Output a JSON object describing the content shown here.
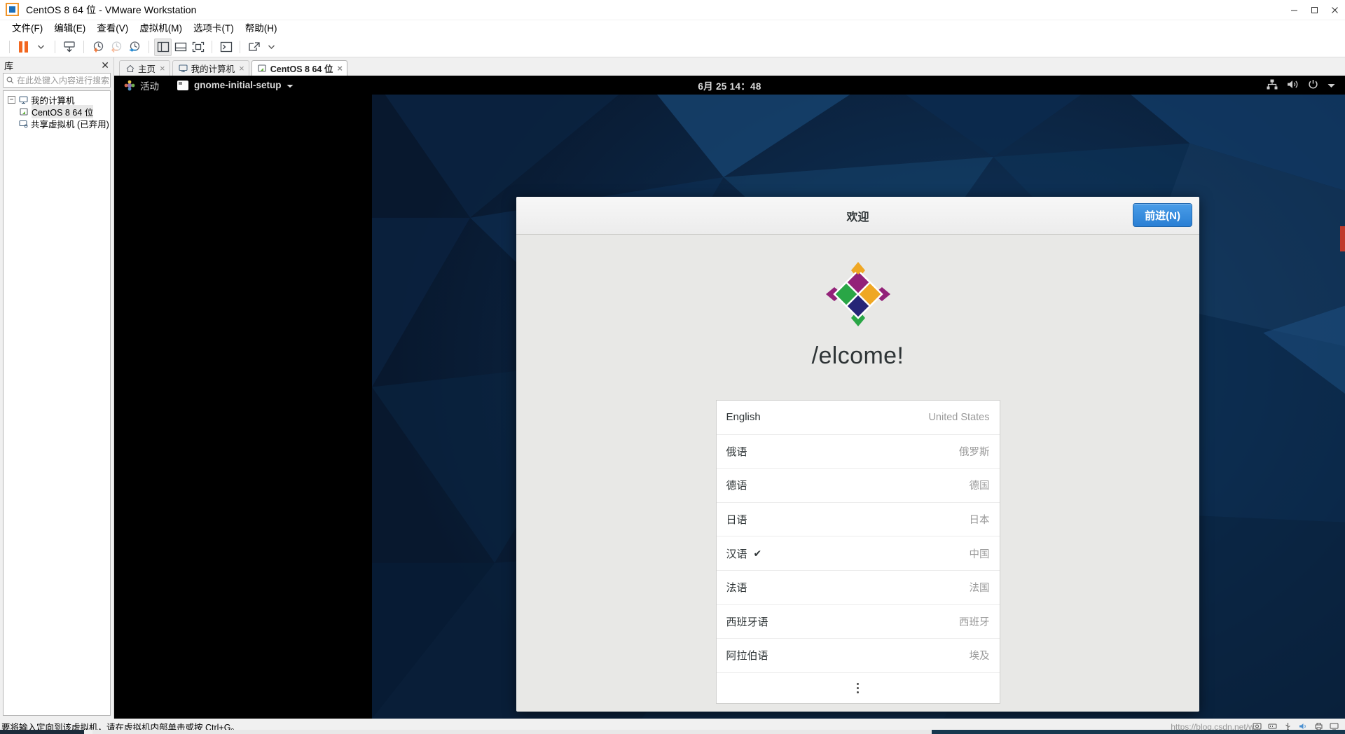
{
  "window": {
    "title": "CentOS 8 64 位 - VMware Workstation",
    "app_icon": "vmware-icon",
    "minimize": "minimize-icon",
    "maximize": "maximize-icon",
    "close": "close-icon"
  },
  "menubar": {
    "items": [
      {
        "label": "文件(F)",
        "name": "menu-file"
      },
      {
        "label": "编辑(E)",
        "name": "menu-edit"
      },
      {
        "label": "查看(V)",
        "name": "menu-view"
      },
      {
        "label": "虚拟机(M)",
        "name": "menu-vm"
      },
      {
        "label": "选项卡(T)",
        "name": "menu-tabs"
      },
      {
        "label": "帮助(H)",
        "name": "menu-help"
      }
    ]
  },
  "toolbar": {
    "buttons": [
      {
        "name": "power-pause-button",
        "icon": "pause-icon"
      },
      {
        "name": "power-dropdown-button",
        "icon": "chevron-down-icon"
      },
      {
        "name": "manage-snapshot-button",
        "icon": "snapshot-manager-icon"
      },
      {
        "name": "take-snapshot-button",
        "icon": "snapshot-add-icon"
      },
      {
        "name": "revert-snapshot-button",
        "icon": "snapshot-revert-icon"
      },
      {
        "name": "snapshot-manager-button",
        "icon": "snapshot-settings-icon"
      },
      {
        "name": "show-library-button",
        "icon": "sidebar-panel-icon"
      },
      {
        "name": "show-thumbnail-button",
        "icon": "thumbnail-bar-icon"
      },
      {
        "name": "fullscreen-button",
        "icon": "fullscreen-icon"
      },
      {
        "name": "console-button",
        "icon": "terminal-icon"
      },
      {
        "name": "unity-button",
        "icon": "unity-mode-icon"
      },
      {
        "name": "unity-dropdown-button",
        "icon": "chevron-down-icon"
      }
    ]
  },
  "sidebar": {
    "header": "库",
    "close_icon": "close-icon",
    "search": {
      "placeholder": "在此处键入内容进行搜索",
      "value": "",
      "icon": "search-icon",
      "dropdown_icon": "chevron-down-icon"
    },
    "tree": [
      {
        "label": "我的计算机",
        "icon": "computer-icon",
        "expander": "−",
        "indent": false,
        "selected": false
      },
      {
        "label": "CentOS 8 64 位",
        "icon": "vm-running-icon",
        "expander": "",
        "indent": true,
        "selected": true
      },
      {
        "label": "共享虚拟机 (已弃用)",
        "icon": "shared-vm-icon",
        "expander": "",
        "indent": false,
        "selected": false
      }
    ]
  },
  "tabs": [
    {
      "label": "主页",
      "icon": "home-icon",
      "active": false,
      "close_icon": "×"
    },
    {
      "label": "我的计算机",
      "icon": "computer-icon",
      "active": false,
      "close_icon": "×"
    },
    {
      "label": "CentOS 8 64 位",
      "icon": "vm-running-icon",
      "active": true,
      "close_icon": "×"
    }
  ],
  "guest": {
    "topbar": {
      "activities": "活动",
      "activities_icon": "gnome-foot-icon",
      "app_name": "gnome-initial-setup",
      "app_icon": "window-icon",
      "app_dropdown_icon": "chevron-down-icon",
      "clock": "6月 25  14：48",
      "status_icons": [
        {
          "name": "network-icon"
        },
        {
          "name": "volume-icon"
        },
        {
          "name": "power-icon"
        },
        {
          "name": "chevron-down-icon"
        }
      ]
    },
    "dialog": {
      "title": "欢迎",
      "next_button": "前进(N)",
      "logo_name": "centos-logo",
      "heading": "/elcome!",
      "languages": [
        {
          "name": "English",
          "region": "United States",
          "selected": false
        },
        {
          "name": "俄语",
          "region": "俄罗斯",
          "selected": false
        },
        {
          "name": "德语",
          "region": "德国",
          "selected": false
        },
        {
          "name": "日语",
          "region": "日本",
          "selected": false
        },
        {
          "name": "汉语",
          "region": "中国",
          "selected": true
        },
        {
          "name": "法语",
          "region": "法国",
          "selected": false
        },
        {
          "name": "西班牙语",
          "region": "西班牙",
          "selected": false
        },
        {
          "name": "阿拉伯语",
          "region": "埃及",
          "selected": false
        }
      ],
      "check_glyph": "✔",
      "more_icon": "more-vertical-icon"
    }
  },
  "statusbar": {
    "message": "要将输入定向到该虚拟机，请在虚拟机内部单击或按 Ctrl+G。",
    "watermark": "https://blog.csdn.net/w...",
    "icons": [
      {
        "name": "hard-disk-icon"
      },
      {
        "name": "network-adapter-icon"
      },
      {
        "name": "usb-icon"
      },
      {
        "name": "sound-card-icon"
      },
      {
        "name": "printer-icon"
      },
      {
        "name": "display-icon"
      }
    ]
  },
  "colors": {
    "accent": "#2a7fd4",
    "orange": "#f2671f",
    "desktop": "#0d2a4b"
  }
}
